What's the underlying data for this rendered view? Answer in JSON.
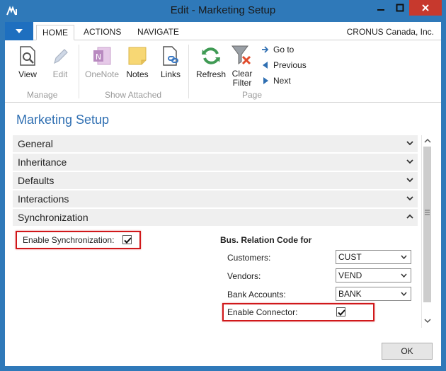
{
  "window": {
    "title": "Edit - Marketing Setup",
    "company": "CRONUS Canada, Inc."
  },
  "tabs": [
    {
      "label": "HOME",
      "active": true
    },
    {
      "label": "ACTIONS",
      "active": false
    },
    {
      "label": "NAVIGATE",
      "active": false
    }
  ],
  "ribbon": {
    "view": "View",
    "edit": "Edit",
    "onenote": "OneNote",
    "notes": "Notes",
    "links": "Links",
    "refresh": "Refresh",
    "clear_filter_1": "Clear",
    "clear_filter_2": "Filter",
    "goto": "Go to",
    "previous": "Previous",
    "next": "Next",
    "group_manage": "Manage",
    "group_show_attached": "Show Attached",
    "group_page": "Page"
  },
  "page_title": "Marketing Setup",
  "fasttabs": [
    {
      "label": "General",
      "expanded": false
    },
    {
      "label": "Inheritance",
      "expanded": false
    },
    {
      "label": "Defaults",
      "expanded": false
    },
    {
      "label": "Interactions",
      "expanded": false
    },
    {
      "label": "Synchronization",
      "expanded": true
    }
  ],
  "sync": {
    "enable_sync_label": "Enable Synchronization:",
    "enable_sync_checked": true,
    "bus_relation_header": "Bus. Relation Code for",
    "customers_label": "Customers:",
    "customers_value": "CUST",
    "vendors_label": "Vendors:",
    "vendors_value": "VEND",
    "bank_label": "Bank Accounts:",
    "bank_value": "BANK",
    "enable_connector_label": "Enable Connector:",
    "enable_connector_checked": true
  },
  "ok_label": "OK",
  "colors": {
    "accent": "#2f79b9",
    "title_blue": "#2f6fb2",
    "highlight_red": "#d0181a"
  }
}
